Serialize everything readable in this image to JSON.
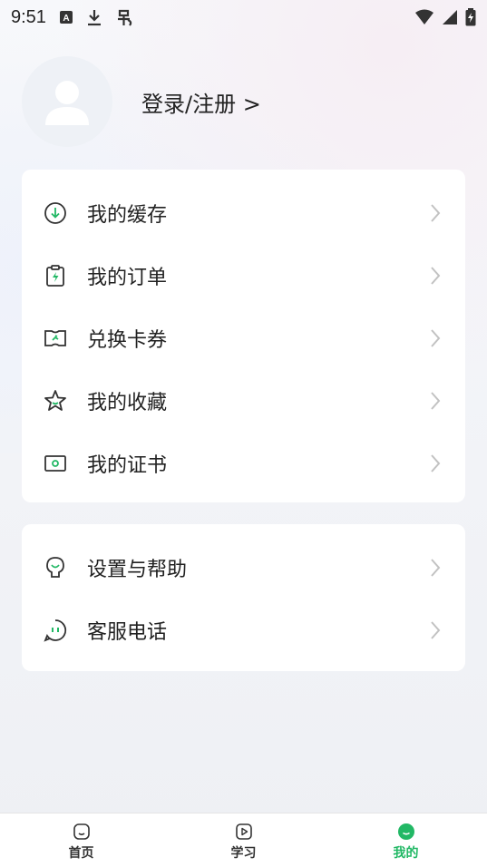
{
  "status_bar": {
    "time": "9:51",
    "icons": [
      "keyboard-a-icon",
      "download-icon",
      "bug-icon",
      "wifi-icon",
      "signal-icon",
      "battery-charging-icon"
    ]
  },
  "profile": {
    "login_label": "登录/注册 >"
  },
  "menu_main": [
    {
      "label": "我的缓存",
      "icon": "download-circle-icon"
    },
    {
      "label": "我的订单",
      "icon": "order-clipboard-icon"
    },
    {
      "label": "兑换卡券",
      "icon": "coupon-icon"
    },
    {
      "label": "我的收藏",
      "icon": "star-icon"
    },
    {
      "label": "我的证书",
      "icon": "certificate-icon"
    }
  ],
  "menu_secondary": [
    {
      "label": "设置与帮助",
      "icon": "bulb-icon"
    },
    {
      "label": "客服电话",
      "icon": "chat-icon"
    }
  ],
  "tabbar": {
    "tabs": [
      {
        "label": "首页",
        "icon": "home-icon",
        "active": false
      },
      {
        "label": "学习",
        "icon": "play-icon",
        "active": false
      },
      {
        "label": "我的",
        "icon": "profile-face-icon",
        "active": true
      }
    ]
  },
  "colors": {
    "accent": "#22b865",
    "icon_stroke": "#333333",
    "chevron": "#c2c2c2"
  }
}
